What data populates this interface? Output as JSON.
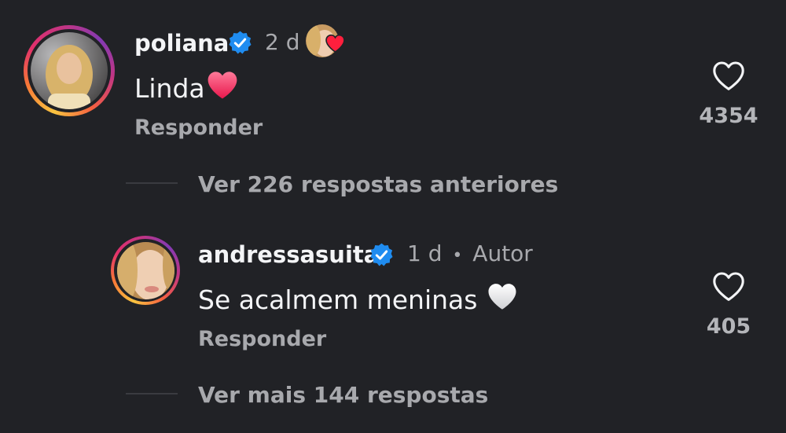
{
  "comment1": {
    "username": "poliana",
    "time": "2 d",
    "text": "Linda",
    "text_emoji": "red-heart",
    "reply_label": "Responder",
    "like_count": "4354",
    "author_liked": true
  },
  "view_previous": {
    "label": "Ver 226 respostas anteriores"
  },
  "comment2": {
    "username": "andressasuita",
    "time": "1 d",
    "separator": "•",
    "author_badge": "Autor",
    "text": "Se acalmem meninas",
    "text_emoji": "white-heart",
    "reply_label": "Responder",
    "like_count": "405"
  },
  "view_more": {
    "label": "Ver mais 144 respostas"
  },
  "colors": {
    "background": "#212226",
    "verified": "#1f8cf0",
    "heart_red": "#ff2d55",
    "secondary_text": "#a8a9ad"
  }
}
